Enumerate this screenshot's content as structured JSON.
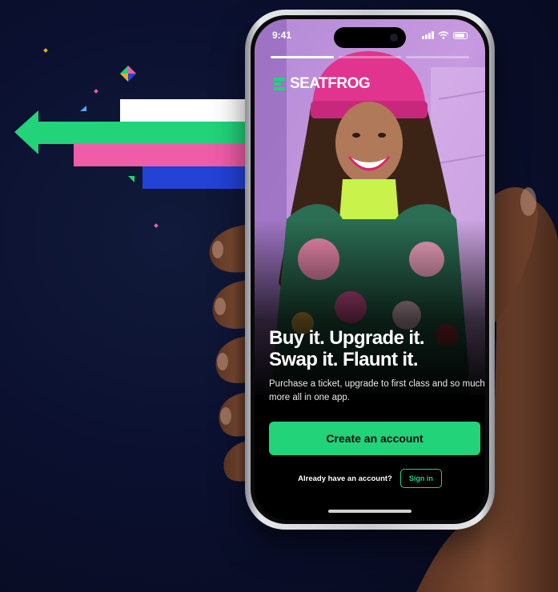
{
  "status_bar": {
    "time": "9:41"
  },
  "stories": {
    "count": 3,
    "active_index": 0,
    "active_progress": 1.0
  },
  "brand": {
    "name": "SEATFROG",
    "accent_color": "#22d37a"
  },
  "hero": {
    "headline_line1": "Buy it. Upgrade it.",
    "headline_line2": "Swap it. Flaunt it.",
    "subtext": "Purchase a ticket, upgrade to first class and so much more all in one app."
  },
  "actions": {
    "create_account_label": "Create an account",
    "signin_question": "Already have an account?",
    "signin_label": "Sign in"
  },
  "icons": {
    "signal": "cellular-signal-icon",
    "wifi": "wifi-icon",
    "battery": "battery-icon",
    "logo": "seatfrog-logo-icon"
  },
  "colors": {
    "background": "#0b1030",
    "arrow_green": "#22d37a",
    "stripe_pink": "#ef5da8",
    "stripe_blue": "#2342d6",
    "stripe_white": "#ffffff"
  }
}
